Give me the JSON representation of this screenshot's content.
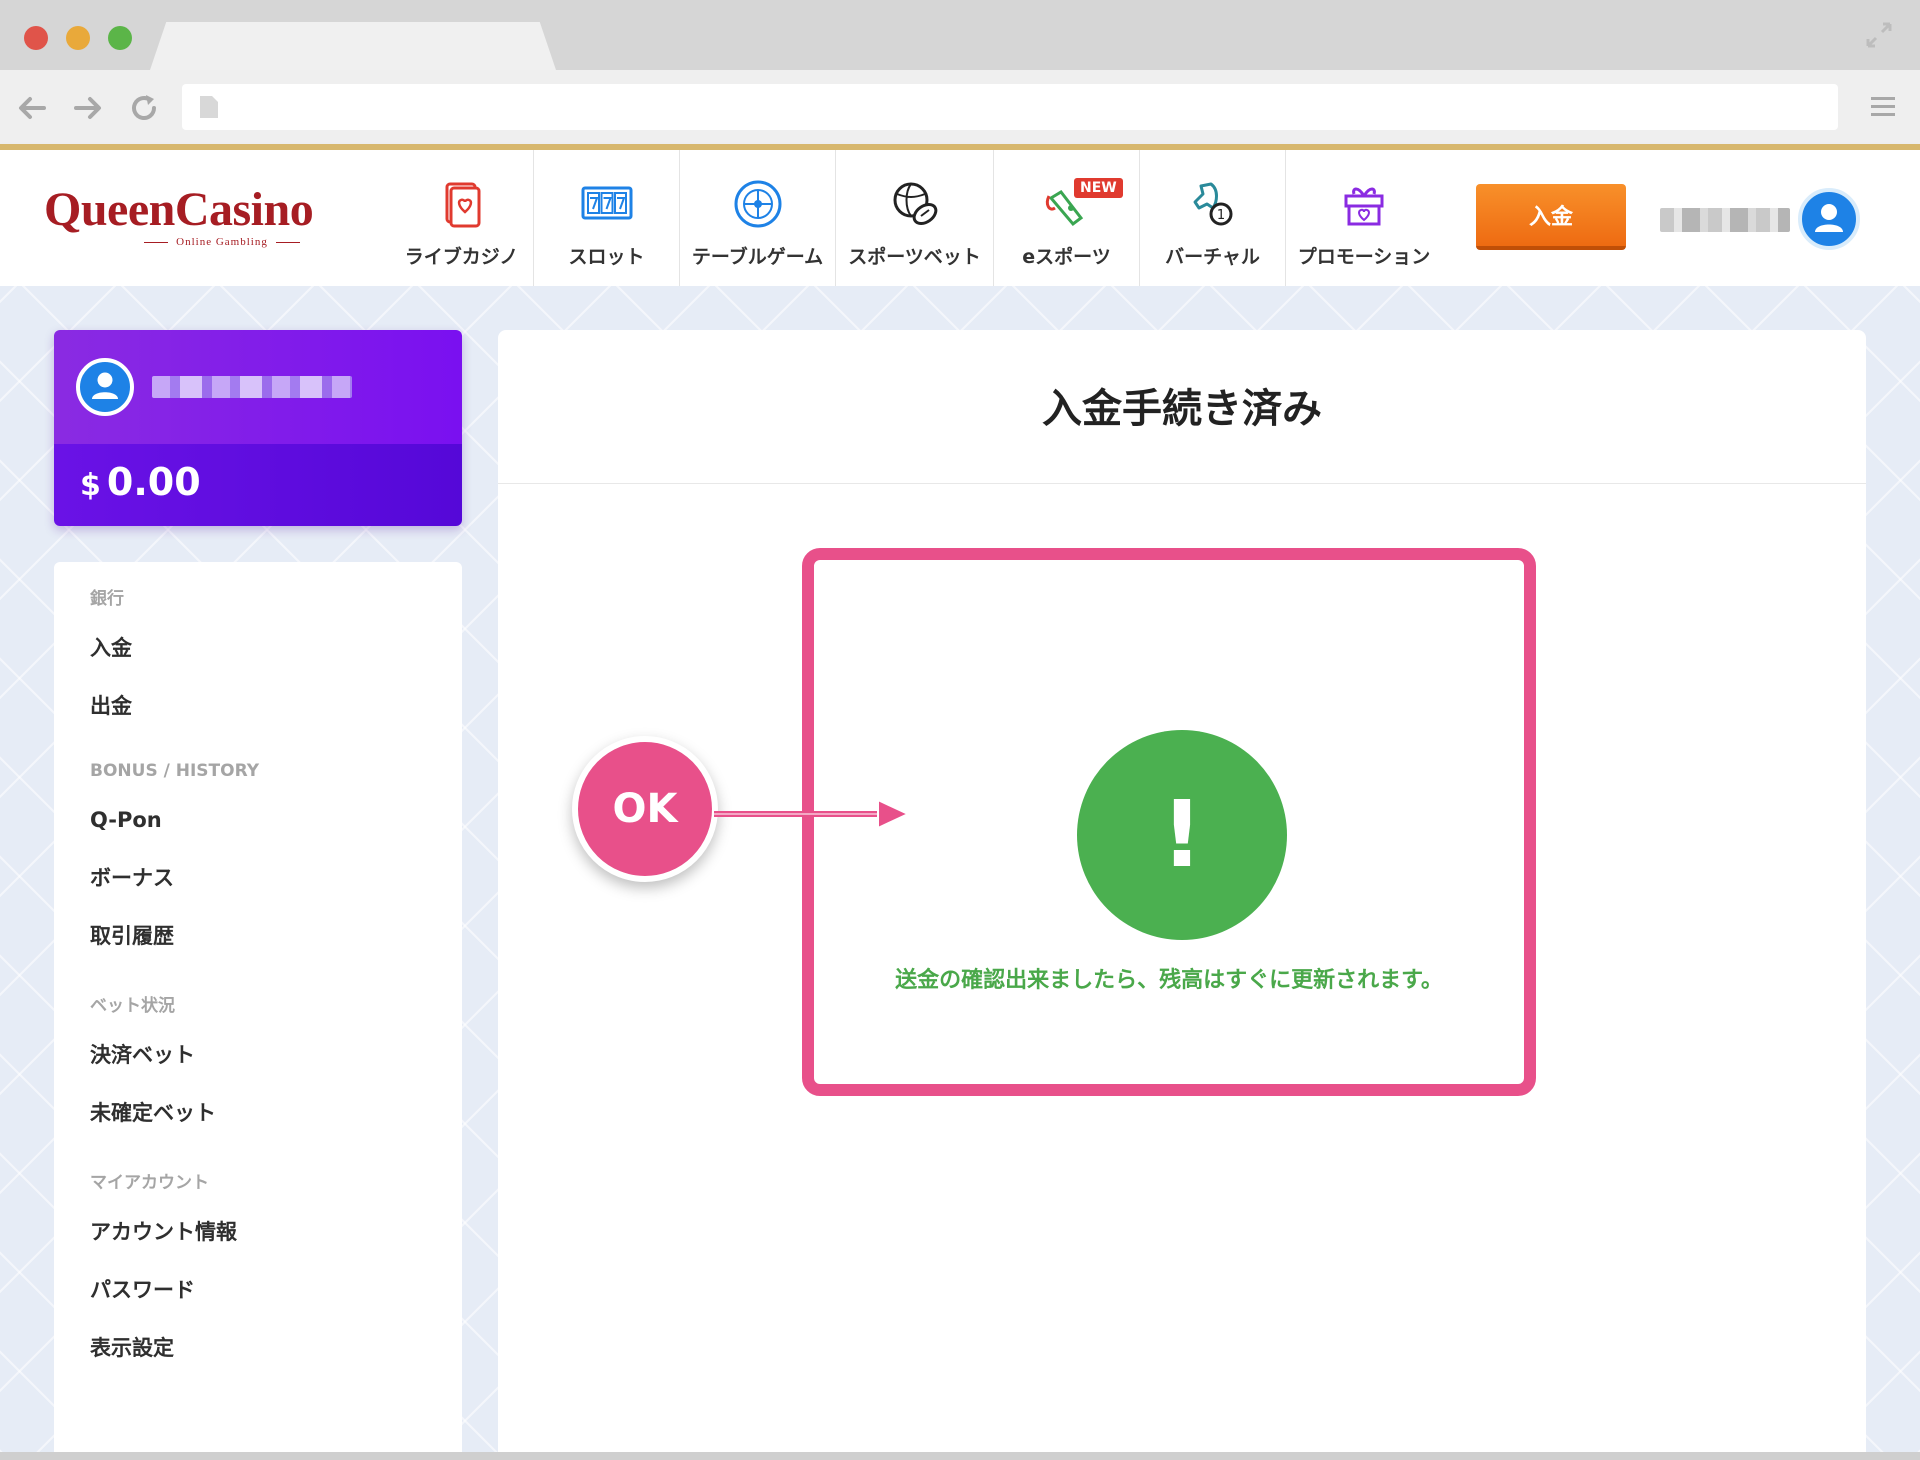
{
  "browser": {
    "address": ""
  },
  "header": {
    "logo_main": "QueenCasino",
    "logo_sub": "Online Gambling",
    "nav": [
      {
        "label": "ライブカジノ",
        "icon": "live-casino-card-icon"
      },
      {
        "label": "スロット",
        "icon": "slot-machine-icon"
      },
      {
        "label": "テーブルゲーム",
        "icon": "roulette-icon"
      },
      {
        "label": "スポーツベット",
        "icon": "sports-ball-icon"
      },
      {
        "label": "eスポーツ",
        "icon": "esports-controller-icon",
        "badge": "NEW"
      },
      {
        "label": "バーチャル",
        "icon": "virtual-horse-icon"
      },
      {
        "label": "プロモーション",
        "icon": "gift-box-icon"
      }
    ],
    "deposit_label": "入金"
  },
  "account": {
    "currency_symbol": "$",
    "balance": "0.00"
  },
  "side_menu": {
    "bank": {
      "heading": "銀行",
      "items": [
        "入金",
        "出金"
      ]
    },
    "bonus_history": {
      "heading": "BONUS / HISTORY",
      "items": [
        "Q-Pon",
        "ボーナス",
        "取引履歴"
      ]
    },
    "bet_status": {
      "heading": "ベット状況",
      "items": [
        "決済ベット",
        "未確定ベット"
      ]
    },
    "my_account": {
      "heading": "マイアカウント",
      "items": [
        "アカウント情報",
        "パスワード",
        "表示設定"
      ]
    }
  },
  "content": {
    "title": "入金手続き済み",
    "status_symbol": "!",
    "message": "送金の確認出来ましたら、残高はすぐに更新されます。"
  },
  "annotation": {
    "ok_label": "OK"
  },
  "colors": {
    "gold_accent": "#d7b76d",
    "logo_red": "#a61d23",
    "deposit_orange": "#f27a1a",
    "balance_purple": "#7a10f0",
    "highlight_pink": "#e8508a",
    "success_green": "#4bb050",
    "nav_icon_blue": "#1e82e6",
    "nav_icon_red": "#e03a2f",
    "nav_icon_purple": "#8a2be2"
  }
}
